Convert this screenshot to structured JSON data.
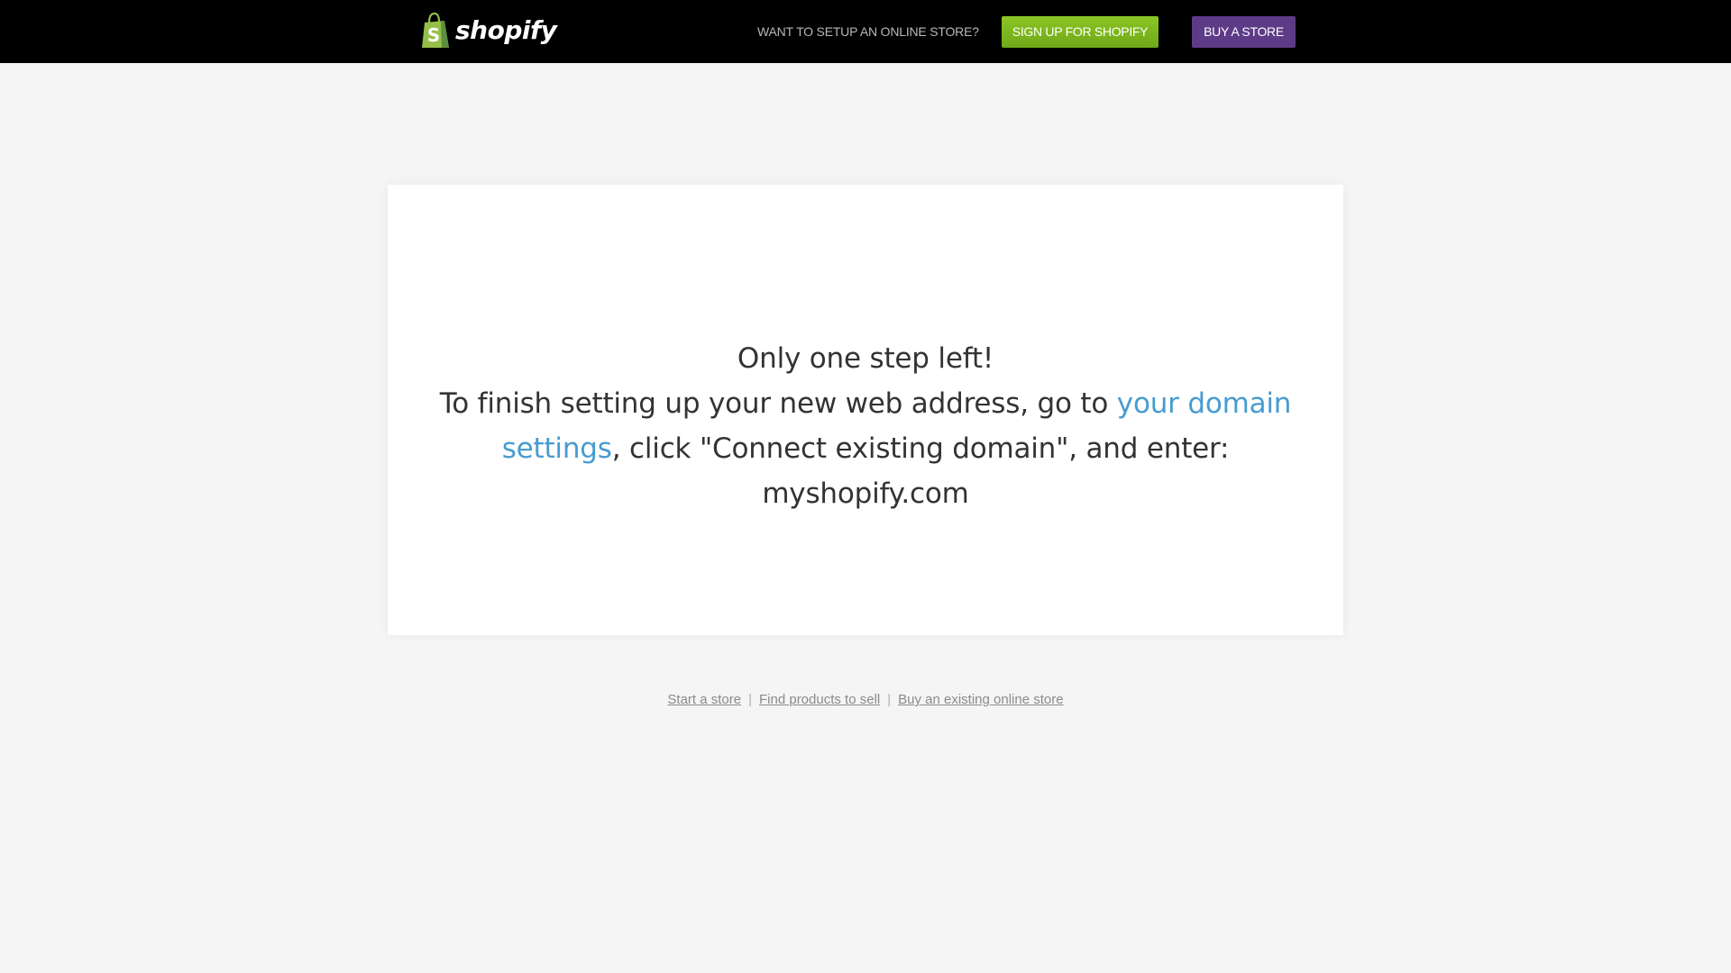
{
  "header": {
    "logo_text": "shopify",
    "logo_icon": "shopping-bag-icon",
    "promo_text": "WANT TO SETUP AN ONLINE STORE?",
    "signup_label": "SIGN UP FOR SHOPIFY",
    "buy_label": "BUY A STORE"
  },
  "main": {
    "headline": "Only one step left!",
    "instruction_before_link": "To finish setting up your new web address, go to ",
    "domain_settings_link": "your domain settings",
    "instruction_after_link": ", click \"Connect existing domain\", and enter: myshopify.com"
  },
  "footer": {
    "links": [
      "Start a store",
      "Find products to sell",
      "Buy an existing online store"
    ],
    "separator": "|"
  },
  "colors": {
    "header_bg": "#000000",
    "page_bg": "#f5f5f5",
    "signup_button": "#7ab51d",
    "buy_button": "#5e3b87",
    "link": "#479ccf",
    "logo_bag": "#95bf47"
  }
}
